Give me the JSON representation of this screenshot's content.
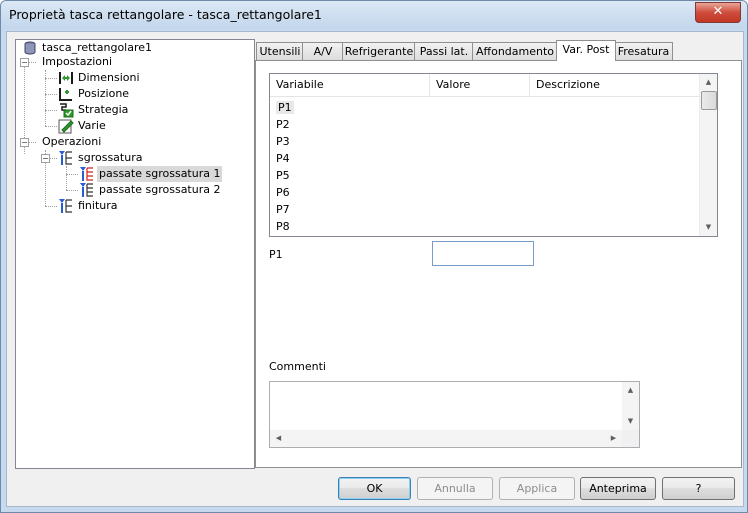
{
  "window": {
    "title": "Proprietà tasca rettangolare - tasca_rettangolare1",
    "close_glyph": "✕"
  },
  "tree": {
    "root": "tasca_rettangolare1",
    "impostazioni": "Impostazioni",
    "dimensioni": "Dimensioni",
    "posizione": "Posizione",
    "strategia": "Strategia",
    "varie": "Varie",
    "operazioni": "Operazioni",
    "sgrossatura": "sgrossatura",
    "passate1": "passate sgrossatura 1",
    "passate2": "passate sgrossatura 2",
    "finitura": "finitura",
    "expanded_glyph": "−"
  },
  "tabs": [
    "Utensili",
    "A/V",
    "Refrigerante",
    "Passi lat.",
    "Affondamento",
    "Var. Post",
    "Fresatura"
  ],
  "active_tab": "Var. Post",
  "list": {
    "columns": [
      "Variabile",
      "Valore",
      "Descrizione"
    ],
    "rows": [
      "P1",
      "P2",
      "P3",
      "P4",
      "P5",
      "P6",
      "P7",
      "P8"
    ],
    "selected_row": "P1"
  },
  "field": {
    "label": "P1",
    "value": ""
  },
  "comments": {
    "label": "Commenti",
    "value": ""
  },
  "buttons": {
    "ok": "OK",
    "annulla": "Annulla",
    "applica": "Applica",
    "anteprima": "Anteprima",
    "help": "?"
  },
  "colors": {
    "accent": "#3c7fb1",
    "close": "#c13625",
    "icon_blue": "#2a5bd7",
    "icon_red": "#d42222",
    "icon_green": "#2d9a2d"
  }
}
